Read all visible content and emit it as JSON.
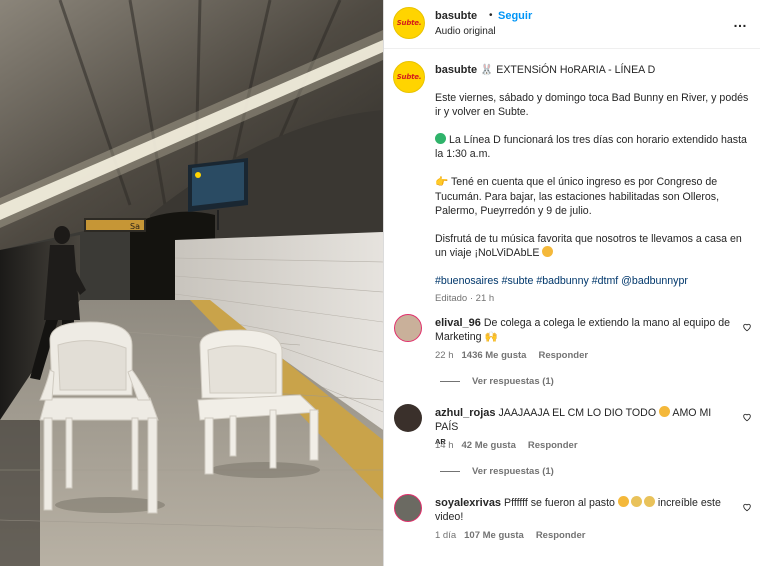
{
  "post": {
    "username": "basubte",
    "dot": "•",
    "follow_label": "Seguir",
    "audio": "Audio original",
    "more_icon": "…",
    "avatar_text": "Subte."
  },
  "caption": {
    "username": "basubte",
    "title": "🐰 EXTENSiÓN HoRARIA - LÍNEA D",
    "p1": "Este viernes, sábado y domingo toca Bad Bunny en River, y podés ir y volver en Subte.",
    "p2": "La Línea D funcionará los tres días con horario extendido hasta la 1:30 a.m.",
    "p3": "Tené en cuenta que el único ingreso es por Congreso de Tucumán. Para bajar, las estaciones habilitadas son Olleros, Palermo, Pueyrredón y 9 de julio.",
    "p4": "Disfrutá de tu música favorita que nosotros te llevamos a casa en un viaje ¡NoLViDAbLE",
    "hashtags": [
      "#buenosaires",
      "#subte",
      "#badbunny",
      "#dtmf",
      "@badbunnypr"
    ],
    "edited": "Editado · 21 h"
  },
  "comments": [
    {
      "username": "elival_96",
      "text": "De colega a colega le extiendo la mano al equipo de Marketing",
      "time": "22 h",
      "likes": "1436 Me gusta",
      "reply": "Responder",
      "view_replies": "Ver respuestas (1)"
    },
    {
      "username": "azhul_rojas",
      "text": "JAAJAAJA EL CM LO DIO TODO",
      "text2": "AMO MI PAÍS",
      "flag": "AR",
      "time": "14 h",
      "likes": "42 Me gusta",
      "reply": "Responder",
      "view_replies": "Ver respuestas (1)"
    },
    {
      "username": "soyalexrivas",
      "text": "Pffffff se fueron al pasto",
      "text2": "increíble este video!",
      "time": "1 día",
      "likes": "107 Me gusta",
      "reply": "Responder"
    }
  ],
  "photo": {
    "sign_text": "Sa"
  },
  "colors": {
    "accent": "#0095f6",
    "hashtag": "#00376b",
    "logo_yellow": "#ffd400",
    "logo_red": "#d41b1b"
  }
}
